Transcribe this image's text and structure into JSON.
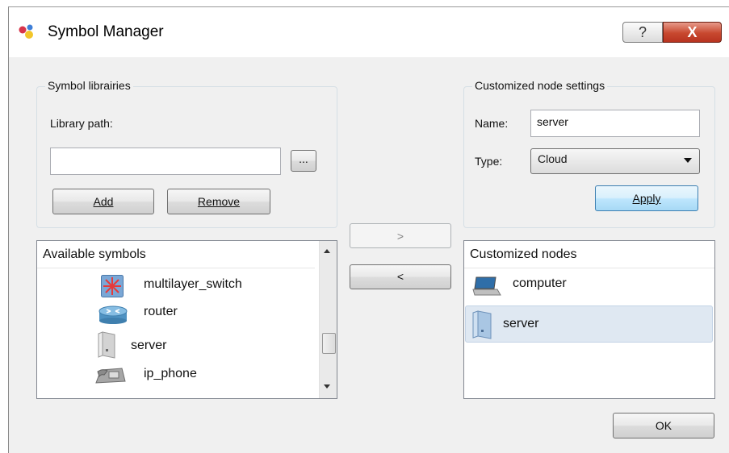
{
  "window": {
    "title": "Symbol Manager",
    "help_glyph": "?",
    "close_glyph": "X"
  },
  "library_group": {
    "title": "Symbol librairies",
    "path_label": "Library path:",
    "path_value": "",
    "browse_label": "...",
    "add_label": "Add",
    "remove_label": "Remove"
  },
  "settings_group": {
    "title": "Customized node settings",
    "name_label": "Name:",
    "name_value": "server",
    "type_label": "Type:",
    "type_value": "Cloud",
    "apply_label": "Apply"
  },
  "transfer": {
    "forward_label": ">",
    "back_label": "<"
  },
  "available": {
    "header": "Available symbols",
    "items": [
      {
        "label": "multilayer_switch",
        "icon": "multilayer-switch-icon"
      },
      {
        "label": "router",
        "icon": "router-icon"
      },
      {
        "label": "server",
        "icon": "server-icon"
      },
      {
        "label": "ip_phone",
        "icon": "ip-phone-icon"
      }
    ]
  },
  "customized": {
    "header": "Customized nodes",
    "items": [
      {
        "label": "computer",
        "icon": "computer-icon"
      },
      {
        "label": "server",
        "icon": "server-icon",
        "selected": true
      }
    ]
  },
  "footer": {
    "ok_label": "OK"
  },
  "colors": {
    "selection": "#dfe8f2",
    "apply_focus": "#bee6fd",
    "close_button": "#c8482f"
  }
}
